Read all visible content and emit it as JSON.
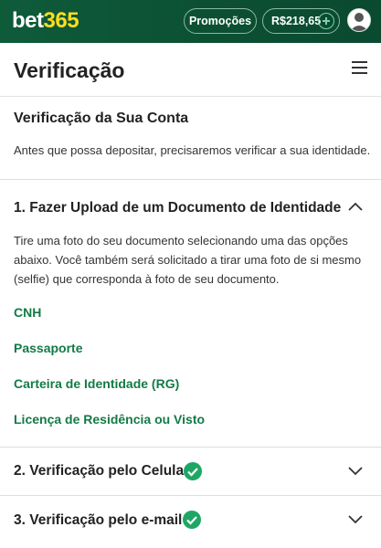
{
  "header": {
    "logo_part1": "bet",
    "logo_part2": "365",
    "promotions_label": "Promoções",
    "balance": "R$218,65",
    "colors": {
      "bar": "#0c4f33",
      "logo_accent": "#ffdf1b"
    }
  },
  "page": {
    "title": "Verificação"
  },
  "account": {
    "title": "Verificação da Sua Conta",
    "intro": "Antes que possa depositar, precisaremos verificar a sua identidade."
  },
  "upload": {
    "title": "1. Fazer Upload de um Documento de Identidade",
    "expanded": true,
    "description": "Tire uma foto do seu documento selecionando uma das opções abaixo. Você também será solicitado a tirar uma foto de si mesmo (selfie) que corresponda à foto de seu documento.",
    "documents": [
      "CNH",
      "Passaporte",
      "Carteira de Identidade (RG)",
      "Licença de Residência ou Visto"
    ]
  },
  "phone_verification": {
    "title": "2. Verificação pelo Celular",
    "status": "verified"
  },
  "email_verification": {
    "title": "3. Verificação pelo e-mail",
    "status": "verified"
  },
  "colors": {
    "link": "#137a46",
    "check": "#1ea665"
  }
}
